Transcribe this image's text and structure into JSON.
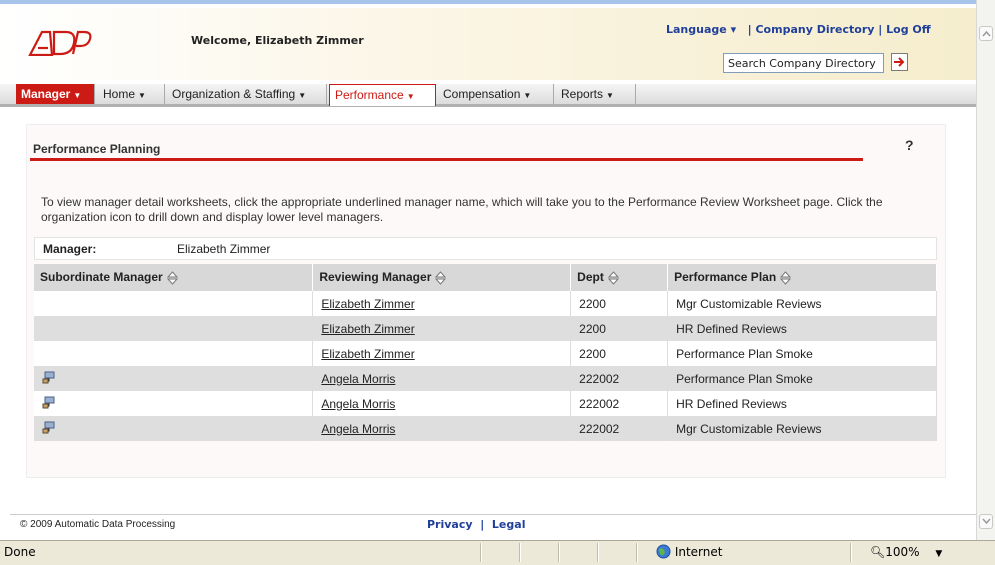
{
  "header": {
    "welcome": "Welcome, Elizabeth Zimmer",
    "language": "Language",
    "company_directory": "Company Directory",
    "separator": "|",
    "log_off": "Log Off",
    "search_placeholder": "Search Company Directory"
  },
  "nav": {
    "tabs": [
      {
        "label": "Manager"
      },
      {
        "label": "Home"
      },
      {
        "label": "Organization & Staffing"
      },
      {
        "label": "Performance"
      },
      {
        "label": "Compensation"
      },
      {
        "label": "Reports"
      }
    ],
    "active": "Performance"
  },
  "page": {
    "title": "Performance Planning",
    "help": "?",
    "instructions": "To view manager detail worksheets, click the appropriate underlined manager name, which will take you to the Performance Review Worksheet page. Click the organization icon to drill down and display lower level managers.",
    "manager_label": "Manager:",
    "manager_value": "Elizabeth Zimmer"
  },
  "table": {
    "headers": [
      "Subordinate Manager",
      "Reviewing Manager",
      "Dept",
      "Performance Plan"
    ],
    "rows": [
      {
        "icon": false,
        "reviewing": "Elizabeth Zimmer",
        "dept": "2200",
        "plan": "Mgr Customizable Reviews"
      },
      {
        "icon": false,
        "reviewing": "Elizabeth Zimmer",
        "dept": "2200",
        "plan": "HR Defined Reviews"
      },
      {
        "icon": false,
        "reviewing": "Elizabeth Zimmer",
        "dept": "2200",
        "plan": "Performance Plan Smoke"
      },
      {
        "icon": true,
        "reviewing": "Angela Morris",
        "dept": "222002",
        "plan": "Performance Plan Smoke"
      },
      {
        "icon": true,
        "reviewing": "Angela Morris",
        "dept": "222002",
        "plan": "HR Defined Reviews"
      },
      {
        "icon": true,
        "reviewing": "Angela Morris",
        "dept": "222002",
        "plan": "Mgr Customizable Reviews"
      }
    ]
  },
  "footer": {
    "copyright": "© 2009 Automatic Data Processing",
    "privacy": "Privacy",
    "separator": "|",
    "legal": "Legal"
  },
  "statusbar": {
    "status": "Done",
    "zone": "Internet",
    "zoom": "100%"
  },
  "colors": {
    "brand_red": "#cc1b14",
    "link_blue": "#1f3f9a",
    "row_shade": "#dedede",
    "header_shade": "#d8d8d8"
  }
}
